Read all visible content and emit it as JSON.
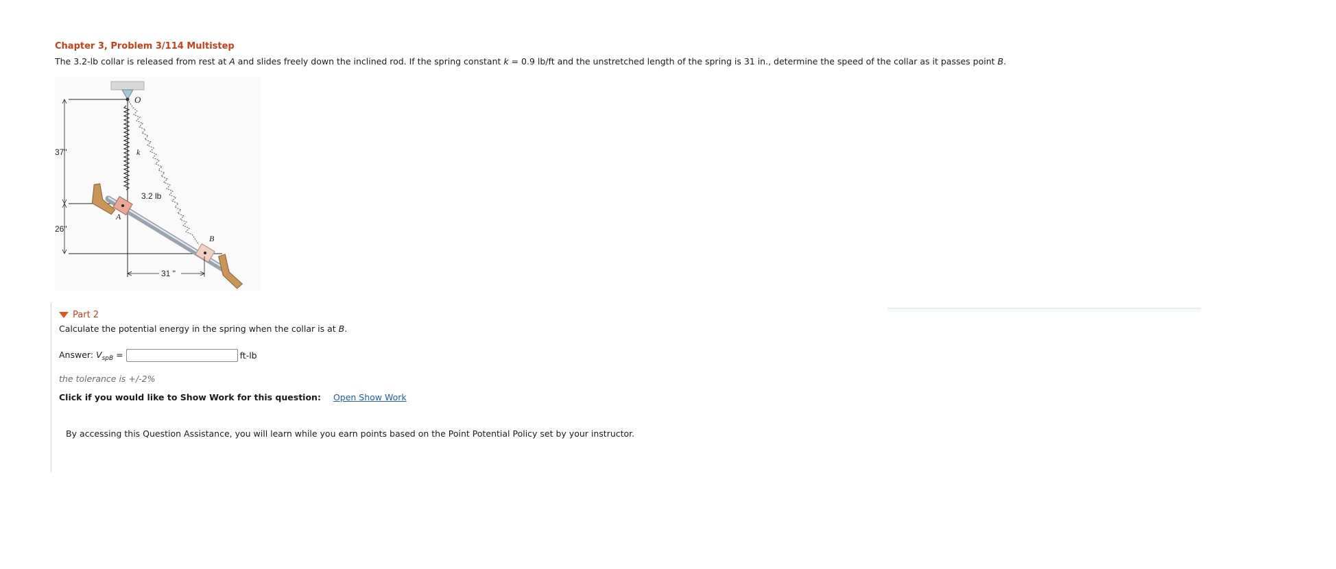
{
  "problem": {
    "title": "Chapter 3, Problem 3/114 Multistep",
    "text_parts": [
      "The 3.2-lb collar is released from rest at ",
      "A",
      " and slides freely down the inclined rod. If the spring constant ",
      "k",
      " = 0.9 lb/ft and the unstretched length of the spring is 31 in., determine the speed of the collar as it passes point ",
      "B",
      "."
    ]
  },
  "figure": {
    "labels": {
      "point_o": "O",
      "spring_k": "k",
      "weight": "3.2 lb",
      "point_a": "A",
      "point_b": "B",
      "dim_vertical_top": "37\"",
      "dim_vertical_bottom": "26\"",
      "dim_horizontal": "31 \""
    }
  },
  "part": {
    "header": "Part 2",
    "question_text": "Calculate the potential energy in the spring when the collar is at ",
    "question_point": "B",
    "question_end": ".",
    "answer_prefix": "Answer: ",
    "answer_var": "V",
    "answer_sub": "spB",
    "answer_eq": " =",
    "answer_value": "",
    "answer_unit": "ft-lb",
    "tolerance": "the tolerance is +/-2%",
    "showwork_question": "Click if you would like to Show Work for this question:",
    "showwork_link": "Open Show Work"
  },
  "assistance_text": "By accessing this Question Assistance, you will learn while you earn points based on the Point Potential Policy set by your instructor.",
  "colors": {
    "accent": "#c8401a",
    "link": "#1f5fb0",
    "collar": "#e8b4a8",
    "support": "#c8955a",
    "rod": "#b8c2cc"
  }
}
